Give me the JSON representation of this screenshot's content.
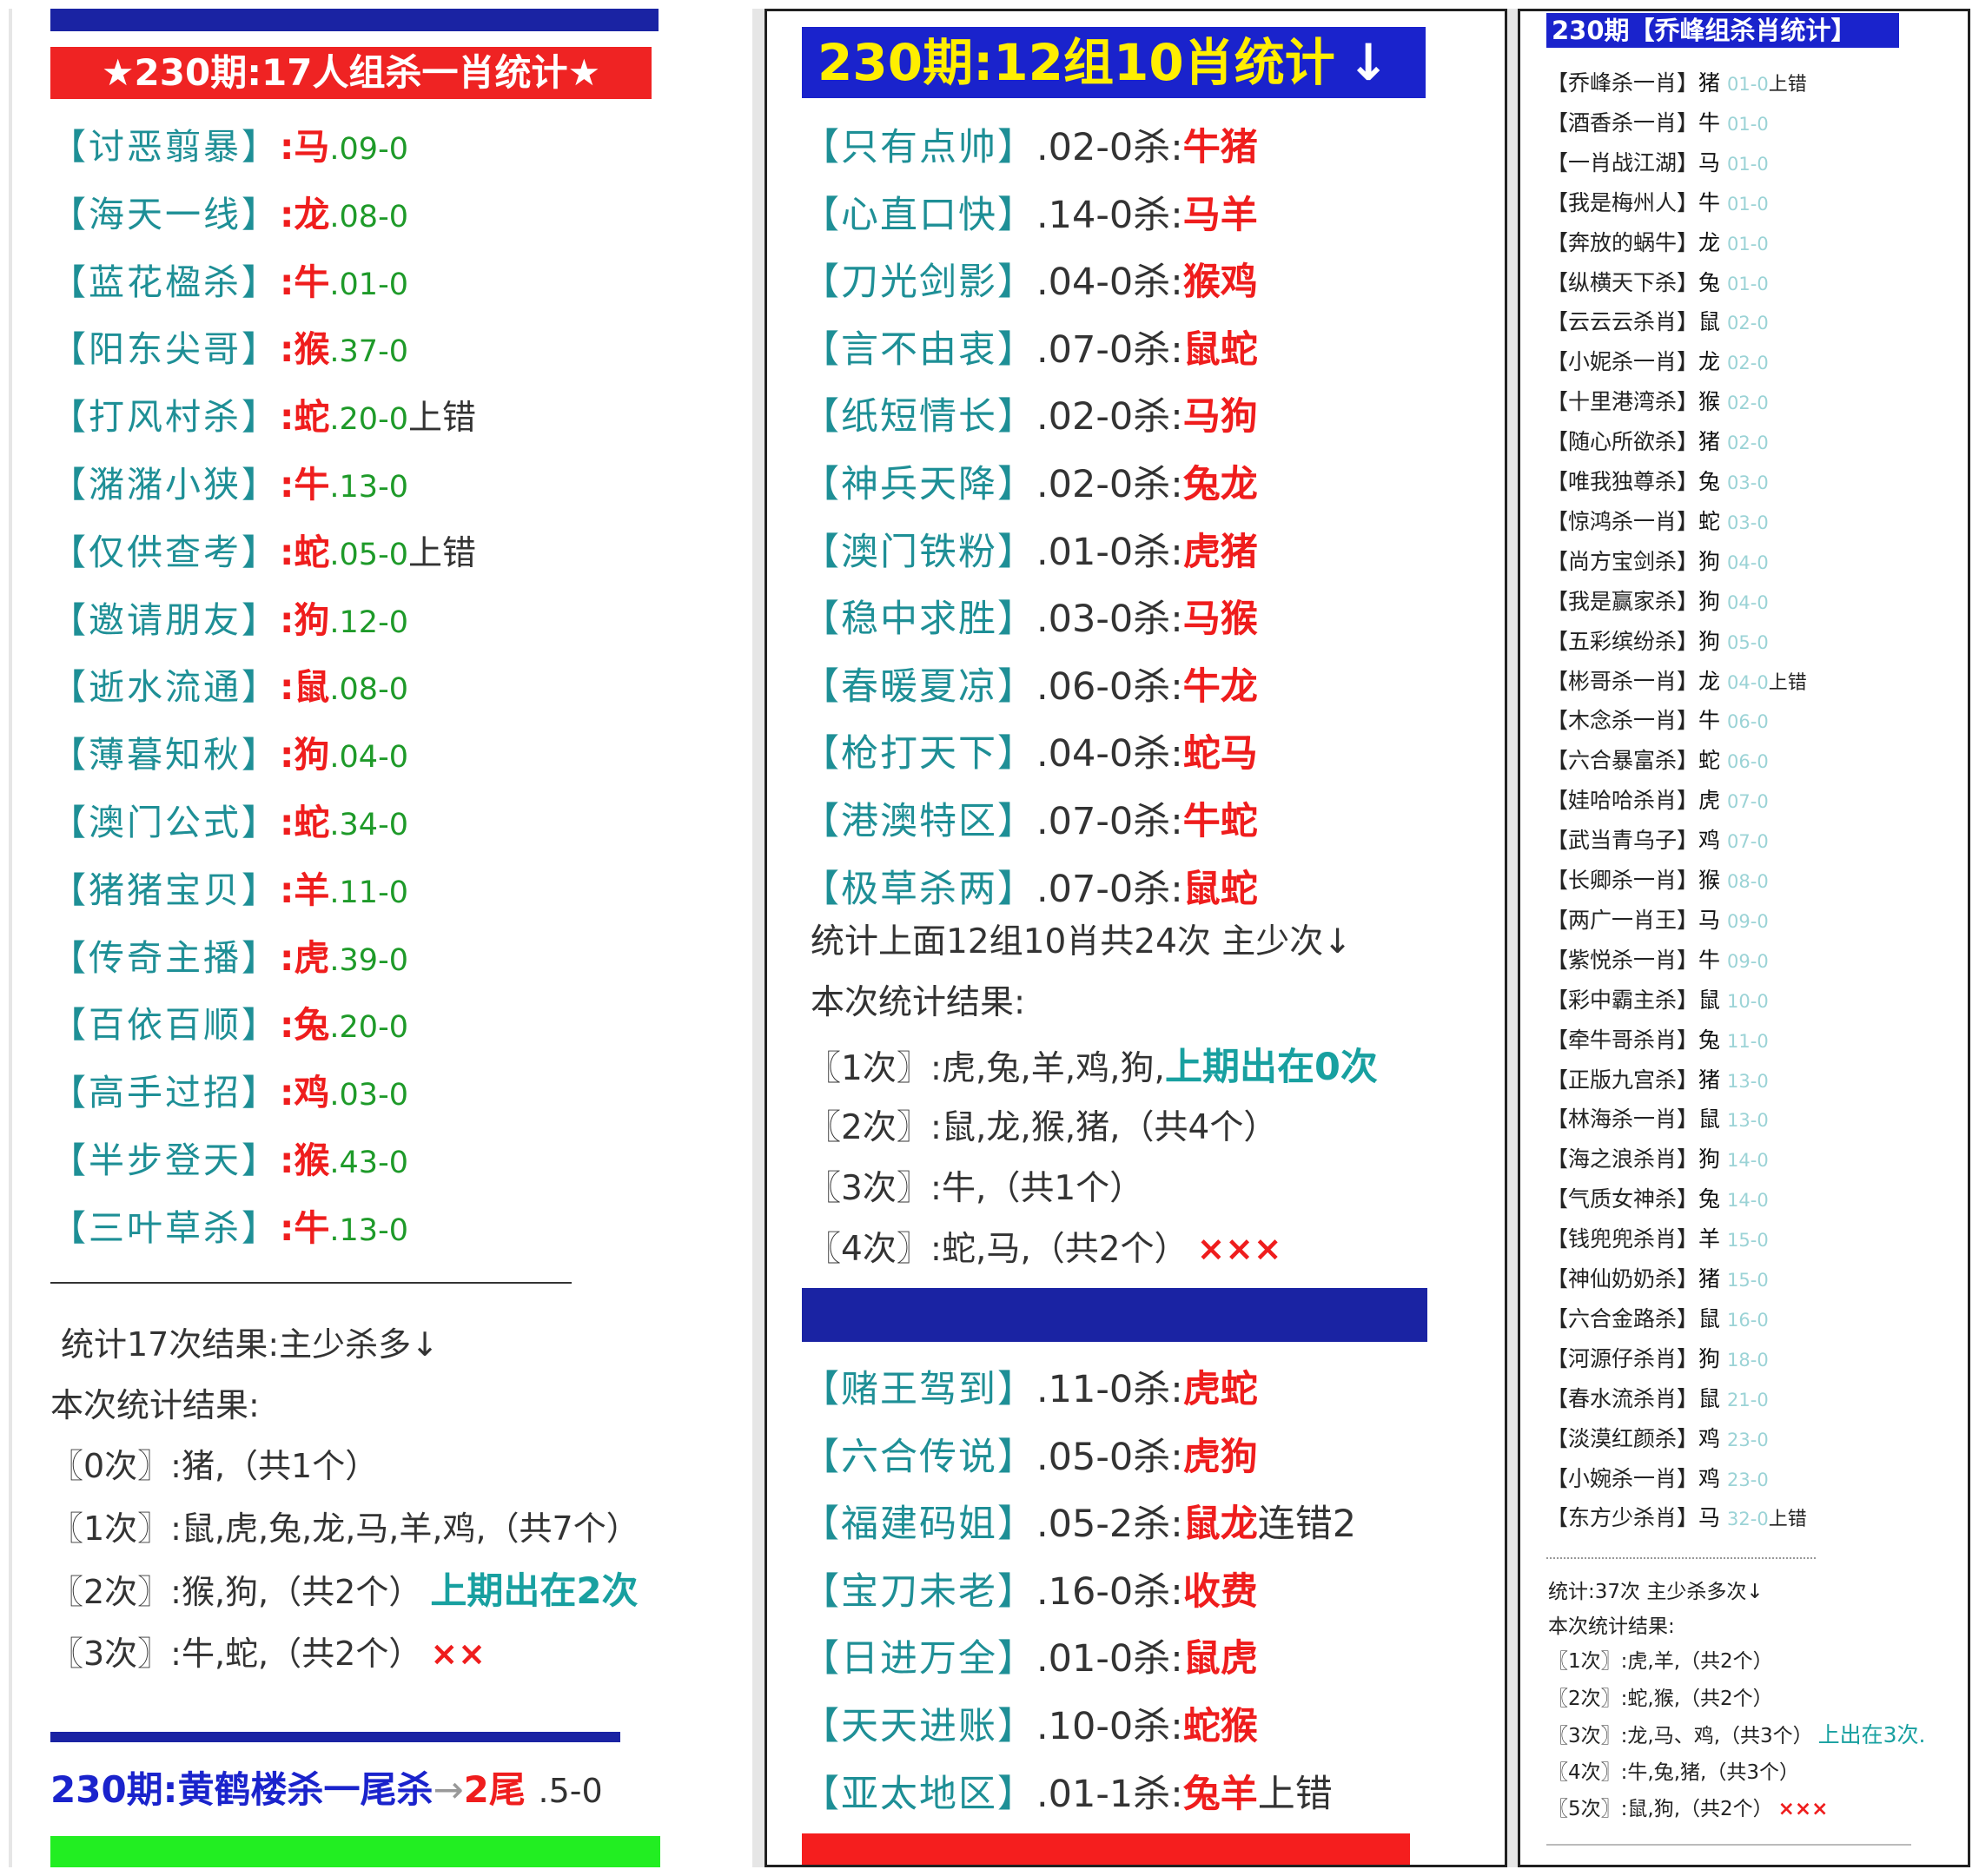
{
  "panel1": {
    "title": "★230期:17人组杀一肖统计★",
    "rows": [
      {
        "name": "【讨恶翦暴】",
        "animal": ":马",
        "score": ".09-0",
        "suffix": ""
      },
      {
        "name": "【海天一线】",
        "animal": ":龙",
        "score": ".08-0",
        "suffix": ""
      },
      {
        "name": "【蓝花楹杀】",
        "animal": ":牛",
        "score": ".01-0",
        "suffix": ""
      },
      {
        "name": "【阳东尖哥】",
        "animal": ":猴",
        "score": ".37-0",
        "suffix": ""
      },
      {
        "name": "【打风村杀】",
        "animal": ":蛇",
        "score": ".20-0",
        "suffix": "上错"
      },
      {
        "name": "【潴潴小狭】",
        "animal": ":牛",
        "score": ".13-0",
        "suffix": ""
      },
      {
        "name": "【仅供查考】",
        "animal": ":蛇",
        "score": ".05-0",
        "suffix": "上错"
      },
      {
        "name": "【邀请朋友】",
        "animal": ":狗",
        "score": ".12-0",
        "suffix": ""
      },
      {
        "name": "【逝水流通】",
        "animal": ":鼠",
        "score": ".08-0",
        "suffix": ""
      },
      {
        "name": "【薄暮知秋】",
        "animal": ":狗",
        "score": ".04-0",
        "suffix": ""
      },
      {
        "name": "【澳门公式】",
        "animal": ":蛇",
        "score": ".34-0",
        "suffix": ""
      },
      {
        "name": "【猪猪宝贝】",
        "animal": ":羊",
        "score": ".11-0",
        "suffix": ""
      },
      {
        "name": "【传奇主播】",
        "animal": ":虎",
        "score": ".39-0",
        "suffix": ""
      },
      {
        "name": "【百依百顺】",
        "animal": ":兔",
        "score": ".20-0",
        "suffix": ""
      },
      {
        "name": "【高手过招】",
        "animal": ":鸡",
        "score": ".03-0",
        "suffix": ""
      },
      {
        "name": "【半步登天】",
        "animal": ":猴",
        "score": ".43-0",
        "suffix": ""
      },
      {
        "name": "【三叶草杀】",
        "animal": ":牛",
        "score": ".13-0",
        "suffix": ""
      }
    ],
    "summary_title": "统计17次结果:主少杀多↓",
    "summary_sub": "本次统计结果:",
    "summary_lines": [
      {
        "text": "〖0次〗:猪,（共1个）",
        "extra": "",
        "mark": ""
      },
      {
        "text": "〖1次〗:鼠,虎,兔,龙,马,羊,鸡,（共7个）",
        "extra": "",
        "mark": ""
      },
      {
        "text": "〖2次〗:猴,狗,（共2个）",
        "extra": "上期出在2次",
        "mark": ""
      },
      {
        "text": "〖3次〗:牛,蛇,（共2个）",
        "extra": "",
        "mark": "××"
      }
    ],
    "footer": {
      "prefix": "230期:黄鹤楼杀一尾杀",
      "arrow": "→",
      "tail": "2尾",
      "score": ".5-0"
    }
  },
  "panel2": {
    "title": "230期:12组10肖统计",
    "title_arrow": "↓",
    "rows": [
      {
        "name": "【只有点帅】",
        "mid": ".02-0杀:",
        "animals": "牛猪",
        "suffix": ""
      },
      {
        "name": "【心直口快】",
        "mid": ".14-0杀:",
        "animals": "马羊",
        "suffix": ""
      },
      {
        "name": "【刀光剑影】",
        "mid": ".04-0杀:",
        "animals": "猴鸡",
        "suffix": ""
      },
      {
        "name": "【言不由衷】",
        "mid": ".07-0杀:",
        "animals": "鼠蛇",
        "suffix": ""
      },
      {
        "name": "【纸短情长】",
        "mid": ".02-0杀:",
        "animals": "马狗",
        "suffix": ""
      },
      {
        "name": "【神兵天降】",
        "mid": ".02-0杀:",
        "animals": "兔龙",
        "suffix": ""
      },
      {
        "name": "【澳门铁粉】",
        "mid": ".01-0杀:",
        "animals": "虎猪",
        "suffix": ""
      },
      {
        "name": "【稳中求胜】",
        "mid": ".03-0杀:",
        "animals": "马猴",
        "suffix": ""
      },
      {
        "name": "【春暖夏凉】",
        "mid": ".06-0杀:",
        "animals": "牛龙",
        "suffix": ""
      },
      {
        "name": "【枪打天下】",
        "mid": ".04-0杀:",
        "animals": "蛇马",
        "suffix": ""
      },
      {
        "name": "【港澳特区】",
        "mid": ".07-0杀:",
        "animals": "牛蛇",
        "suffix": ""
      },
      {
        "name": "【极草杀两】",
        "mid": ".07-0杀:",
        "animals": "鼠蛇",
        "suffix": ""
      }
    ],
    "summary_title": "统计上面12组10肖共24次 主少次↓",
    "summary_sub": "本次统计结果:",
    "summary_lines": [
      {
        "text": "〖1次〗:虎,兔,羊,鸡,狗,",
        "extra": "上期出在0次",
        "mark": ""
      },
      {
        "text": "〖2次〗:鼠,龙,猴,猪,（共4个）",
        "extra": "",
        "mark": ""
      },
      {
        "text": "〖3次〗:牛,（共1个）",
        "extra": "",
        "mark": ""
      },
      {
        "text": "〖4次〗:蛇,马,（共2个）",
        "extra": "",
        "mark": "×××"
      }
    ],
    "rows2": [
      {
        "name": "【赌王驾到】",
        "mid": ".11-0杀:",
        "animals": "虎蛇",
        "suffix": ""
      },
      {
        "name": "【六合传说】",
        "mid": ".05-0杀:",
        "animals": "虎狗",
        "suffix": ""
      },
      {
        "name": "【福建码姐】",
        "mid": ".05-2杀:",
        "animals": "鼠龙",
        "suffix": "连错2"
      },
      {
        "name": "【宝刀未老】",
        "mid": ".16-0杀:",
        "animals": "收费",
        "suffix": ""
      },
      {
        "name": "【日进万全】",
        "mid": ".01-0杀:",
        "animals": "鼠虎",
        "suffix": ""
      },
      {
        "name": "【天天进账】",
        "mid": ".10-0杀:",
        "animals": "蛇猴",
        "suffix": ""
      },
      {
        "name": "【亚太地区】",
        "mid": ".01-1杀:",
        "animals": "兔羊",
        "suffix": "上错"
      }
    ]
  },
  "panel3": {
    "title": "230期【乔峰组杀肖统计】",
    "rows": [
      {
        "name": "【乔峰杀一肖】",
        "animal": "猪",
        "score": "01-0",
        "suffix": "上错"
      },
      {
        "name": "【酒香杀一肖】",
        "animal": "牛",
        "score": "01-0",
        "suffix": ""
      },
      {
        "name": "【一肖战江湖】",
        "animal": "马",
        "score": "01-0",
        "suffix": ""
      },
      {
        "name": "【我是梅州人】",
        "animal": "牛",
        "score": "01-0",
        "suffix": ""
      },
      {
        "name": "【奔放的蜗牛】",
        "animal": "龙",
        "score": "01-0",
        "suffix": ""
      },
      {
        "name": "【纵横天下杀】",
        "animal": "兔",
        "score": "01-0",
        "suffix": ""
      },
      {
        "name": "【云云云杀肖】",
        "animal": "鼠",
        "score": "02-0",
        "suffix": ""
      },
      {
        "name": "【小妮杀一肖】",
        "animal": "龙",
        "score": "02-0",
        "suffix": ""
      },
      {
        "name": "【十里港湾杀】",
        "animal": "猴",
        "score": "02-0",
        "suffix": ""
      },
      {
        "name": "【随心所欲杀】",
        "animal": "猪",
        "score": "02-0",
        "suffix": ""
      },
      {
        "name": "【唯我独尊杀】",
        "animal": "兔",
        "score": "03-0",
        "suffix": ""
      },
      {
        "name": "【惊鸿杀一肖】",
        "animal": "蛇",
        "score": "03-0",
        "suffix": ""
      },
      {
        "name": "【尚方宝剑杀】",
        "animal": "狗",
        "score": "04-0",
        "suffix": ""
      },
      {
        "name": "【我是赢家杀】",
        "animal": "狗",
        "score": "04-0",
        "suffix": ""
      },
      {
        "name": "【五彩缤纷杀】",
        "animal": "狗",
        "score": "05-0",
        "suffix": ""
      },
      {
        "name": "【彬哥杀一肖】",
        "animal": "龙",
        "score": "04-0",
        "suffix": "上错"
      },
      {
        "name": "【木念杀一肖】",
        "animal": "牛",
        "score": "06-0",
        "suffix": ""
      },
      {
        "name": "【六合暴富杀】",
        "animal": "蛇",
        "score": "06-0",
        "suffix": ""
      },
      {
        "name": "【娃哈哈杀肖】",
        "animal": "虎",
        "score": "07-0",
        "suffix": ""
      },
      {
        "name": "【武当青乌子】",
        "animal": "鸡",
        "score": "07-0",
        "suffix": ""
      },
      {
        "name": "【长卿杀一肖】",
        "animal": "猴",
        "score": "08-0",
        "suffix": ""
      },
      {
        "name": "【两广一肖王】",
        "animal": "马",
        "score": "09-0",
        "suffix": ""
      },
      {
        "name": "【紫悦杀一肖】",
        "animal": "牛",
        "score": "09-0",
        "suffix": ""
      },
      {
        "name": "【彩中霸主杀】",
        "animal": "鼠",
        "score": "10-0",
        "suffix": ""
      },
      {
        "name": "【牵牛哥杀肖】",
        "animal": "兔",
        "score": "11-0",
        "suffix": ""
      },
      {
        "name": "【正版九宫杀】",
        "animal": "猪",
        "score": "13-0",
        "suffix": ""
      },
      {
        "name": "【林海杀一肖】",
        "animal": "鼠",
        "score": "13-0",
        "suffix": ""
      },
      {
        "name": "【海之浪杀肖】",
        "animal": "狗",
        "score": "14-0",
        "suffix": ""
      },
      {
        "name": "【气质女神杀】",
        "animal": "兔",
        "score": "14-0",
        "suffix": ""
      },
      {
        "name": "【钱兜兜杀肖】",
        "animal": "羊",
        "score": "15-0",
        "suffix": ""
      },
      {
        "name": "【神仙奶奶杀】",
        "animal": "猪",
        "score": "15-0",
        "suffix": ""
      },
      {
        "name": "【六合金路杀】",
        "animal": "鼠",
        "score": "16-0",
        "suffix": ""
      },
      {
        "name": "【河源仔杀肖】",
        "animal": "狗",
        "score": "18-0",
        "suffix": ""
      },
      {
        "name": "【春水流杀肖】",
        "animal": "鼠",
        "score": "21-0",
        "suffix": ""
      },
      {
        "name": "【淡漠红颜杀】",
        "animal": "鸡",
        "score": "23-0",
        "suffix": ""
      },
      {
        "name": "【小婉杀一肖】",
        "animal": "鸡",
        "score": "23-0",
        "suffix": ""
      },
      {
        "name": "【东方少杀肖】",
        "animal": "马",
        "score": "32-0",
        "suffix": "上错"
      }
    ],
    "summary_title": "统计:37次 主少杀多次↓",
    "summary_sub": "本次统计结果:",
    "summary_lines": [
      {
        "text": "〖1次〗:虎,羊,（共2个）",
        "extra": "",
        "mark": ""
      },
      {
        "text": "〖2次〗:蛇,猴,（共2个）",
        "extra": "",
        "mark": ""
      },
      {
        "text": "〖3次〗:龙,马、鸡,（共3个）",
        "extra": "上出在3次.",
        "mark": ""
      },
      {
        "text": "〖4次〗:牛,兔,猪,（共3个）",
        "extra": "",
        "mark": ""
      },
      {
        "text": "〖5次〗:鼠,狗,（共2个）",
        "extra": "",
        "mark": "×××"
      }
    ]
  }
}
